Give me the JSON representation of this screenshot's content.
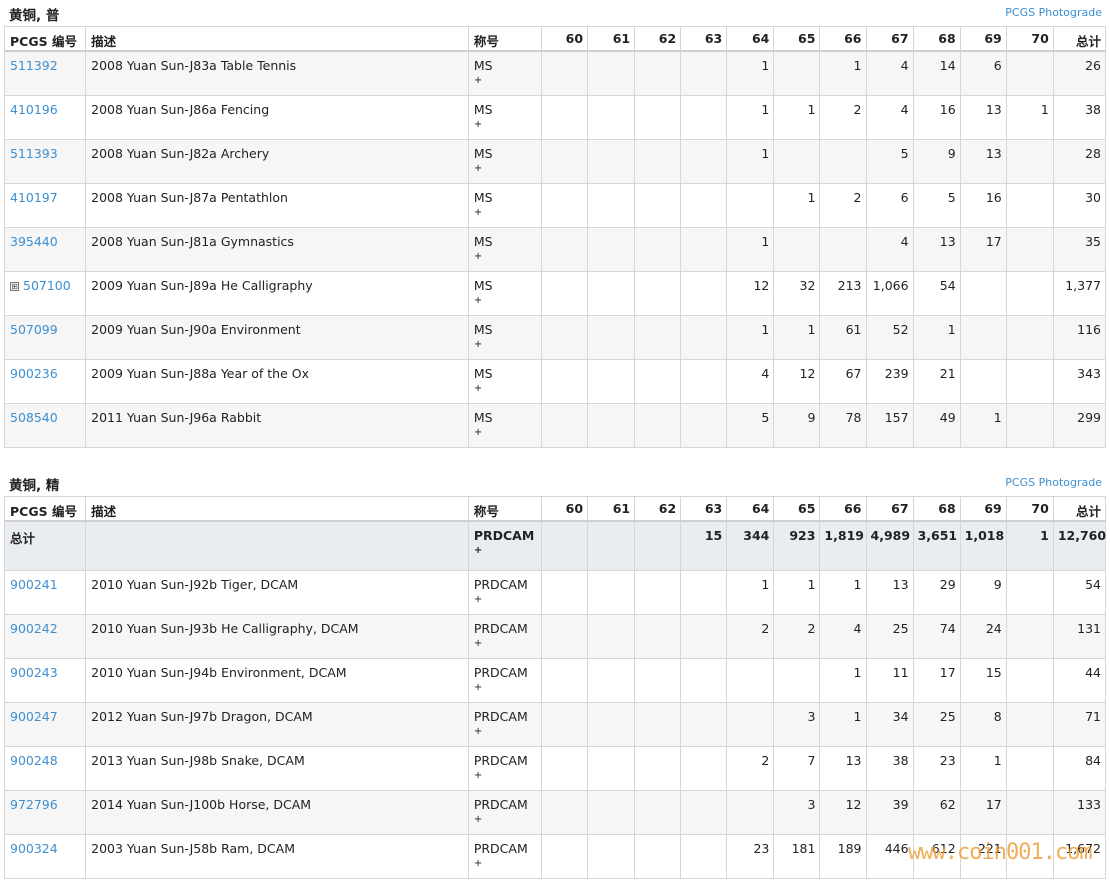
{
  "columns": [
    "PCGS 编号",
    "描述",
    "称号",
    "60",
    "61",
    "62",
    "63",
    "64",
    "65",
    "66",
    "67",
    "68",
    "69",
    "70",
    "总计"
  ],
  "photograde_label": "PCGS Photograde",
  "section1": {
    "title": "黄铜, 普",
    "rows": [
      {
        "id": "511392",
        "desc": "2008 Yuan Sun-J83a Table Tennis",
        "des": "MS",
        "plus": "+",
        "g": [
          "",
          "",
          "",
          "",
          "1",
          "",
          "1",
          "4",
          "14",
          "6",
          ""
        ],
        "total": "26"
      },
      {
        "id": "410196",
        "desc": "2008 Yuan Sun-J86a Fencing",
        "des": "MS",
        "plus": "+",
        "g": [
          "",
          "",
          "",
          "",
          "1",
          "1",
          "2",
          "4",
          "16",
          "13",
          "1"
        ],
        "total": "38"
      },
      {
        "id": "511393",
        "desc": "2008 Yuan Sun-J82a Archery",
        "des": "MS",
        "plus": "+",
        "g": [
          "",
          "",
          "",
          "",
          "1",
          "",
          "",
          "5",
          "9",
          "13",
          ""
        ],
        "total": "28"
      },
      {
        "id": "410197",
        "desc": "2008 Yuan Sun-J87a Pentathlon",
        "des": "MS",
        "plus": "+",
        "g": [
          "",
          "",
          "",
          "",
          "",
          "1",
          "2",
          "6",
          "5",
          "16",
          ""
        ],
        "total": "30"
      },
      {
        "id": "395440",
        "desc": "2008 Yuan Sun-J81a Gymnastics",
        "des": "MS",
        "plus": "+",
        "g": [
          "",
          "",
          "",
          "",
          "1",
          "",
          "",
          "4",
          "13",
          "17",
          ""
        ],
        "total": "35"
      },
      {
        "id": "507100",
        "expand": "⊞",
        "desc": "2009 Yuan Sun-J89a He Calligraphy",
        "des": "MS",
        "plus": "+",
        "g": [
          "",
          "",
          "",
          "",
          "12",
          "32",
          "213",
          "1,066",
          "54",
          "",
          ""
        ],
        "total": "1,377"
      },
      {
        "id": "507099",
        "desc": "2009 Yuan Sun-J90a Environment",
        "des": "MS",
        "plus": "+",
        "g": [
          "",
          "",
          "",
          "",
          "1",
          "1",
          "61",
          "52",
          "1",
          "",
          ""
        ],
        "total": "116"
      },
      {
        "id": "900236",
        "desc": "2009 Yuan Sun-J88a Year of the Ox",
        "des": "MS",
        "plus": "+",
        "g": [
          "",
          "",
          "",
          "",
          "4",
          "12",
          "67",
          "239",
          "21",
          "",
          ""
        ],
        "total": "343"
      },
      {
        "id": "508540",
        "desc": "2011 Yuan Sun-J96a Rabbit",
        "des": "MS",
        "plus": "+",
        "g": [
          "",
          "",
          "",
          "",
          "5",
          "9",
          "78",
          "157",
          "49",
          "1",
          ""
        ],
        "total": "299"
      }
    ]
  },
  "section2": {
    "title": "黄铜, 精",
    "total_row": {
      "label": "总计",
      "des": "PRDCAM",
      "plus": "+",
      "g": [
        "",
        "",
        "",
        "15",
        "344",
        "923",
        "1,819",
        "4,989",
        "3,651",
        "1,018",
        "1"
      ],
      "total": "12,760"
    },
    "rows": [
      {
        "id": "900241",
        "desc": "2010 Yuan Sun-J92b Tiger, DCAM",
        "des": "PRDCAM",
        "plus": "+",
        "g": [
          "",
          "",
          "",
          "",
          "1",
          "1",
          "1",
          "13",
          "29",
          "9",
          ""
        ],
        "total": "54"
      },
      {
        "id": "900242",
        "desc": "2010 Yuan Sun-J93b He Calligraphy, DCAM",
        "des": "PRDCAM",
        "plus": "+",
        "g": [
          "",
          "",
          "",
          "",
          "2",
          "2",
          "4",
          "25",
          "74",
          "24",
          ""
        ],
        "total": "131"
      },
      {
        "id": "900243",
        "desc": "2010 Yuan Sun-J94b Environment, DCAM",
        "des": "PRDCAM",
        "plus": "+",
        "g": [
          "",
          "",
          "",
          "",
          "",
          "",
          "1",
          "11",
          "17",
          "15",
          ""
        ],
        "total": "44"
      },
      {
        "id": "900247",
        "desc": "2012 Yuan Sun-J97b Dragon, DCAM",
        "des": "PRDCAM",
        "plus": "+",
        "g": [
          "",
          "",
          "",
          "",
          "",
          "3",
          "1",
          "34",
          "25",
          "8",
          ""
        ],
        "total": "71"
      },
      {
        "id": "900248",
        "desc": "2013 Yuan Sun-J98b Snake, DCAM",
        "des": "PRDCAM",
        "plus": "+",
        "g": [
          "",
          "",
          "",
          "",
          "2",
          "7",
          "13",
          "38",
          "23",
          "1",
          ""
        ],
        "total": "84"
      },
      {
        "id": "972796",
        "desc": "2014 Yuan Sun-J100b Horse, DCAM",
        "des": "PRDCAM",
        "plus": "+",
        "g": [
          "",
          "",
          "",
          "",
          "",
          "3",
          "12",
          "39",
          "62",
          "17",
          ""
        ],
        "total": "133"
      },
      {
        "id": "900324",
        "desc": "2003 Yuan Sun-J58b Ram, DCAM",
        "des": "PRDCAM",
        "plus": "+",
        "g": [
          "",
          "",
          "",
          "",
          "23",
          "181",
          "189",
          "446",
          "612",
          "221",
          ""
        ],
        "total": "1,672"
      }
    ]
  },
  "watermark": "www.coin001.com"
}
